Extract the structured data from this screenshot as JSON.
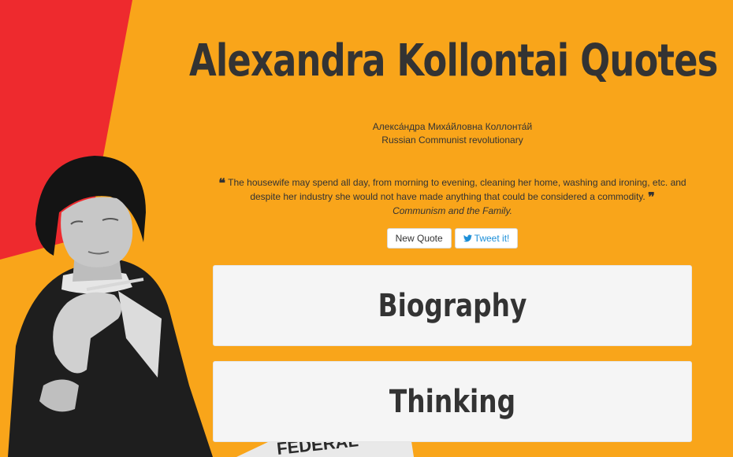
{
  "page": {
    "title": "Alexandra Kollontai Quotes",
    "native_name": "Алекса́ндра Миха́йловна Коллонта́й",
    "description": "Russian Communist revolutionary"
  },
  "quote": {
    "text": "The housewife may spend all day, from morning to evening, cleaning her home, washing and ironing, etc. and despite her industry she would not have made anything that could be considered a commodity.",
    "source": "Communism and the Family.",
    "open_mark": "❝",
    "close_mark": "❞"
  },
  "buttons": {
    "new_quote": "New Quote",
    "tweet": "Tweet it!"
  },
  "cards": {
    "biography": "Biography",
    "thinking": "Thinking"
  },
  "portrait": {
    "banner_text": "FEDERAL"
  },
  "colors": {
    "background": "#f9a51a",
    "red_band": "#ee2a2e",
    "text": "#333333",
    "card": "#f5f5f5",
    "twitter": "#1c8fd8"
  },
  "icons": {
    "quote_open": "quote-open-icon",
    "quote_close": "quote-close-icon",
    "tweet": "twitter-bird-icon"
  }
}
